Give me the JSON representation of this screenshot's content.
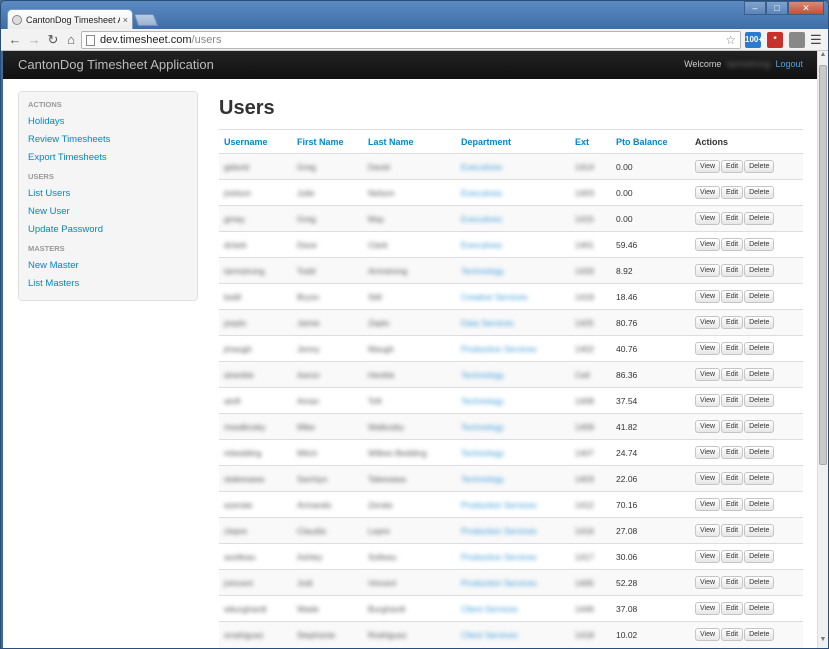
{
  "browser": {
    "tab_title": "CantonDog Timesheet Ap",
    "tab_close": "×",
    "url_host": "dev.timesheet.com",
    "url_path": "/users",
    "ext_counter": "100+",
    "ext_lastpass": "*",
    "win_min": "–",
    "win_max": "□",
    "win_close": "✕"
  },
  "navbar": {
    "brand": "CantonDog Timesheet Application",
    "welcome_label": "Welcome",
    "username": "tarmstrong",
    "logout": "Logout"
  },
  "sidebar": {
    "groups": [
      {
        "header": "ACTIONS",
        "items": [
          "Holidays",
          "Review Timesheets",
          "Export Timesheets"
        ]
      },
      {
        "header": "USERS",
        "items": [
          "List Users",
          "New User",
          "Update Password"
        ]
      },
      {
        "header": "MASTERS",
        "items": [
          "New Master",
          "List Masters"
        ]
      }
    ]
  },
  "main": {
    "title": "Users",
    "columns": [
      "Username",
      "First Name",
      "Last Name",
      "Department",
      "Ext",
      "Pto Balance",
      "Actions"
    ],
    "action_labels": {
      "view": "View",
      "edit": "Edit",
      "delete": "Delete"
    },
    "rows": [
      {
        "username": "gdavid",
        "first": "Greg",
        "last": "David",
        "dept": "Executives",
        "ext": "1414",
        "pto": "0.00"
      },
      {
        "username": "jnelson",
        "first": "Julie",
        "last": "Nelson",
        "dept": "Executives",
        "ext": "1403",
        "pto": "0.00"
      },
      {
        "username": "gmay",
        "first": "Greg",
        "last": "May",
        "dept": "Executives",
        "ext": "1415",
        "pto": "0.00"
      },
      {
        "username": "dclark",
        "first": "Dave",
        "last": "Clark",
        "dept": "Executives",
        "ext": "1401",
        "pto": "59.46"
      },
      {
        "username": "tarmstrong",
        "first": "Todd",
        "last": "Armstrong",
        "dept": "Technology",
        "ext": "1433",
        "pto": "8.92"
      },
      {
        "username": "bstill",
        "first": "Bryon",
        "last": "Still",
        "dept": "Creative Services",
        "ext": "1419",
        "pto": "18.46"
      },
      {
        "username": "jzeplo",
        "first": "Jamie",
        "last": "Zeplo",
        "dept": "Data Services",
        "ext": "1425",
        "pto": "80.76"
      },
      {
        "username": "jmaugh",
        "first": "Jenny",
        "last": "Maugh",
        "dept": "Production Services",
        "ext": "1402",
        "pto": "40.76"
      },
      {
        "username": "ahenkle",
        "first": "Aaron",
        "last": "Henkle",
        "dept": "Technology",
        "ext": "Cell",
        "pto": "86.36"
      },
      {
        "username": "atoft",
        "first": "Aman",
        "last": "Toft",
        "dept": "Technology",
        "ext": "1408",
        "pto": "37.54"
      },
      {
        "username": "mwalkosky",
        "first": "Mike",
        "last": "Walkosky",
        "dept": "Technology",
        "ext": "1409",
        "pto": "41.82"
      },
      {
        "username": "mbedding",
        "first": "Mitch",
        "last": "Wilkes Bedding",
        "dept": "Technology",
        "ext": "1407",
        "pto": "24.74"
      },
      {
        "username": "stakesawa",
        "first": "Sachiyo",
        "last": "Takesawa",
        "dept": "Technology",
        "ext": "1403",
        "pto": "22.06"
      },
      {
        "username": "azerate",
        "first": "Armando",
        "last": "Zerate",
        "dept": "Production Services",
        "ext": "1412",
        "pto": "70.16"
      },
      {
        "username": "clepre",
        "first": "Claudia",
        "last": "Lepre",
        "dept": "Production Services",
        "ext": "1416",
        "pto": "27.08"
      },
      {
        "username": "asolleau",
        "first": "Ashley",
        "last": "Solleau",
        "dept": "Production Services",
        "ext": "1417",
        "pto": "30.06"
      },
      {
        "username": "jvincent",
        "first": "Jodi",
        "last": "Vincent",
        "dept": "Production Services",
        "ext": "1405",
        "pto": "52.28"
      },
      {
        "username": "wburghardt",
        "first": "Wade",
        "last": "Burghardt",
        "dept": "Client Services",
        "ext": "1446",
        "pto": "37.08"
      },
      {
        "username": "srodriguez",
        "first": "Stephanie",
        "last": "Rodriguez",
        "dept": "Client Services",
        "ext": "1418",
        "pto": "10.02"
      }
    ]
  }
}
